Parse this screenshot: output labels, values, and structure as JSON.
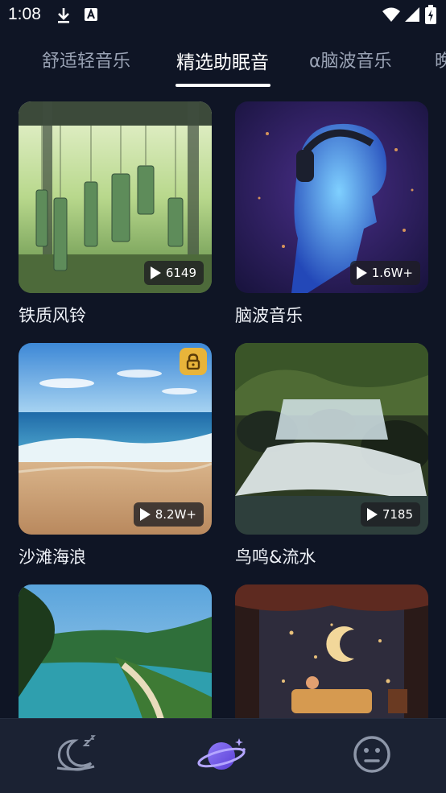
{
  "status": {
    "time": "1:08"
  },
  "tabs": [
    {
      "label": "舒适轻音乐"
    },
    {
      "label": "精选助眠音"
    },
    {
      "label": "α脑波音乐"
    },
    {
      "label": "晚"
    }
  ],
  "cards": [
    {
      "title": "铁质风铃",
      "plays": "6149"
    },
    {
      "title": "脑波音乐",
      "plays": "1.6W+"
    },
    {
      "title": "沙滩海浪",
      "plays": "8.2W+",
      "locked": true
    },
    {
      "title": "鸟鸣&流水",
      "plays": "7185"
    },
    {
      "title": "",
      "plays": ""
    },
    {
      "title": "",
      "plays": ""
    }
  ],
  "nav": {
    "items": [
      {
        "icon": "moon-sleep-icon"
      },
      {
        "icon": "planet-icon",
        "active": true
      },
      {
        "icon": "face-icon"
      }
    ]
  },
  "colors": {
    "background": "#0f1525",
    "nav_bg": "#1b2233",
    "accent": "#7b6cf0",
    "lock": "#e8b43a"
  }
}
